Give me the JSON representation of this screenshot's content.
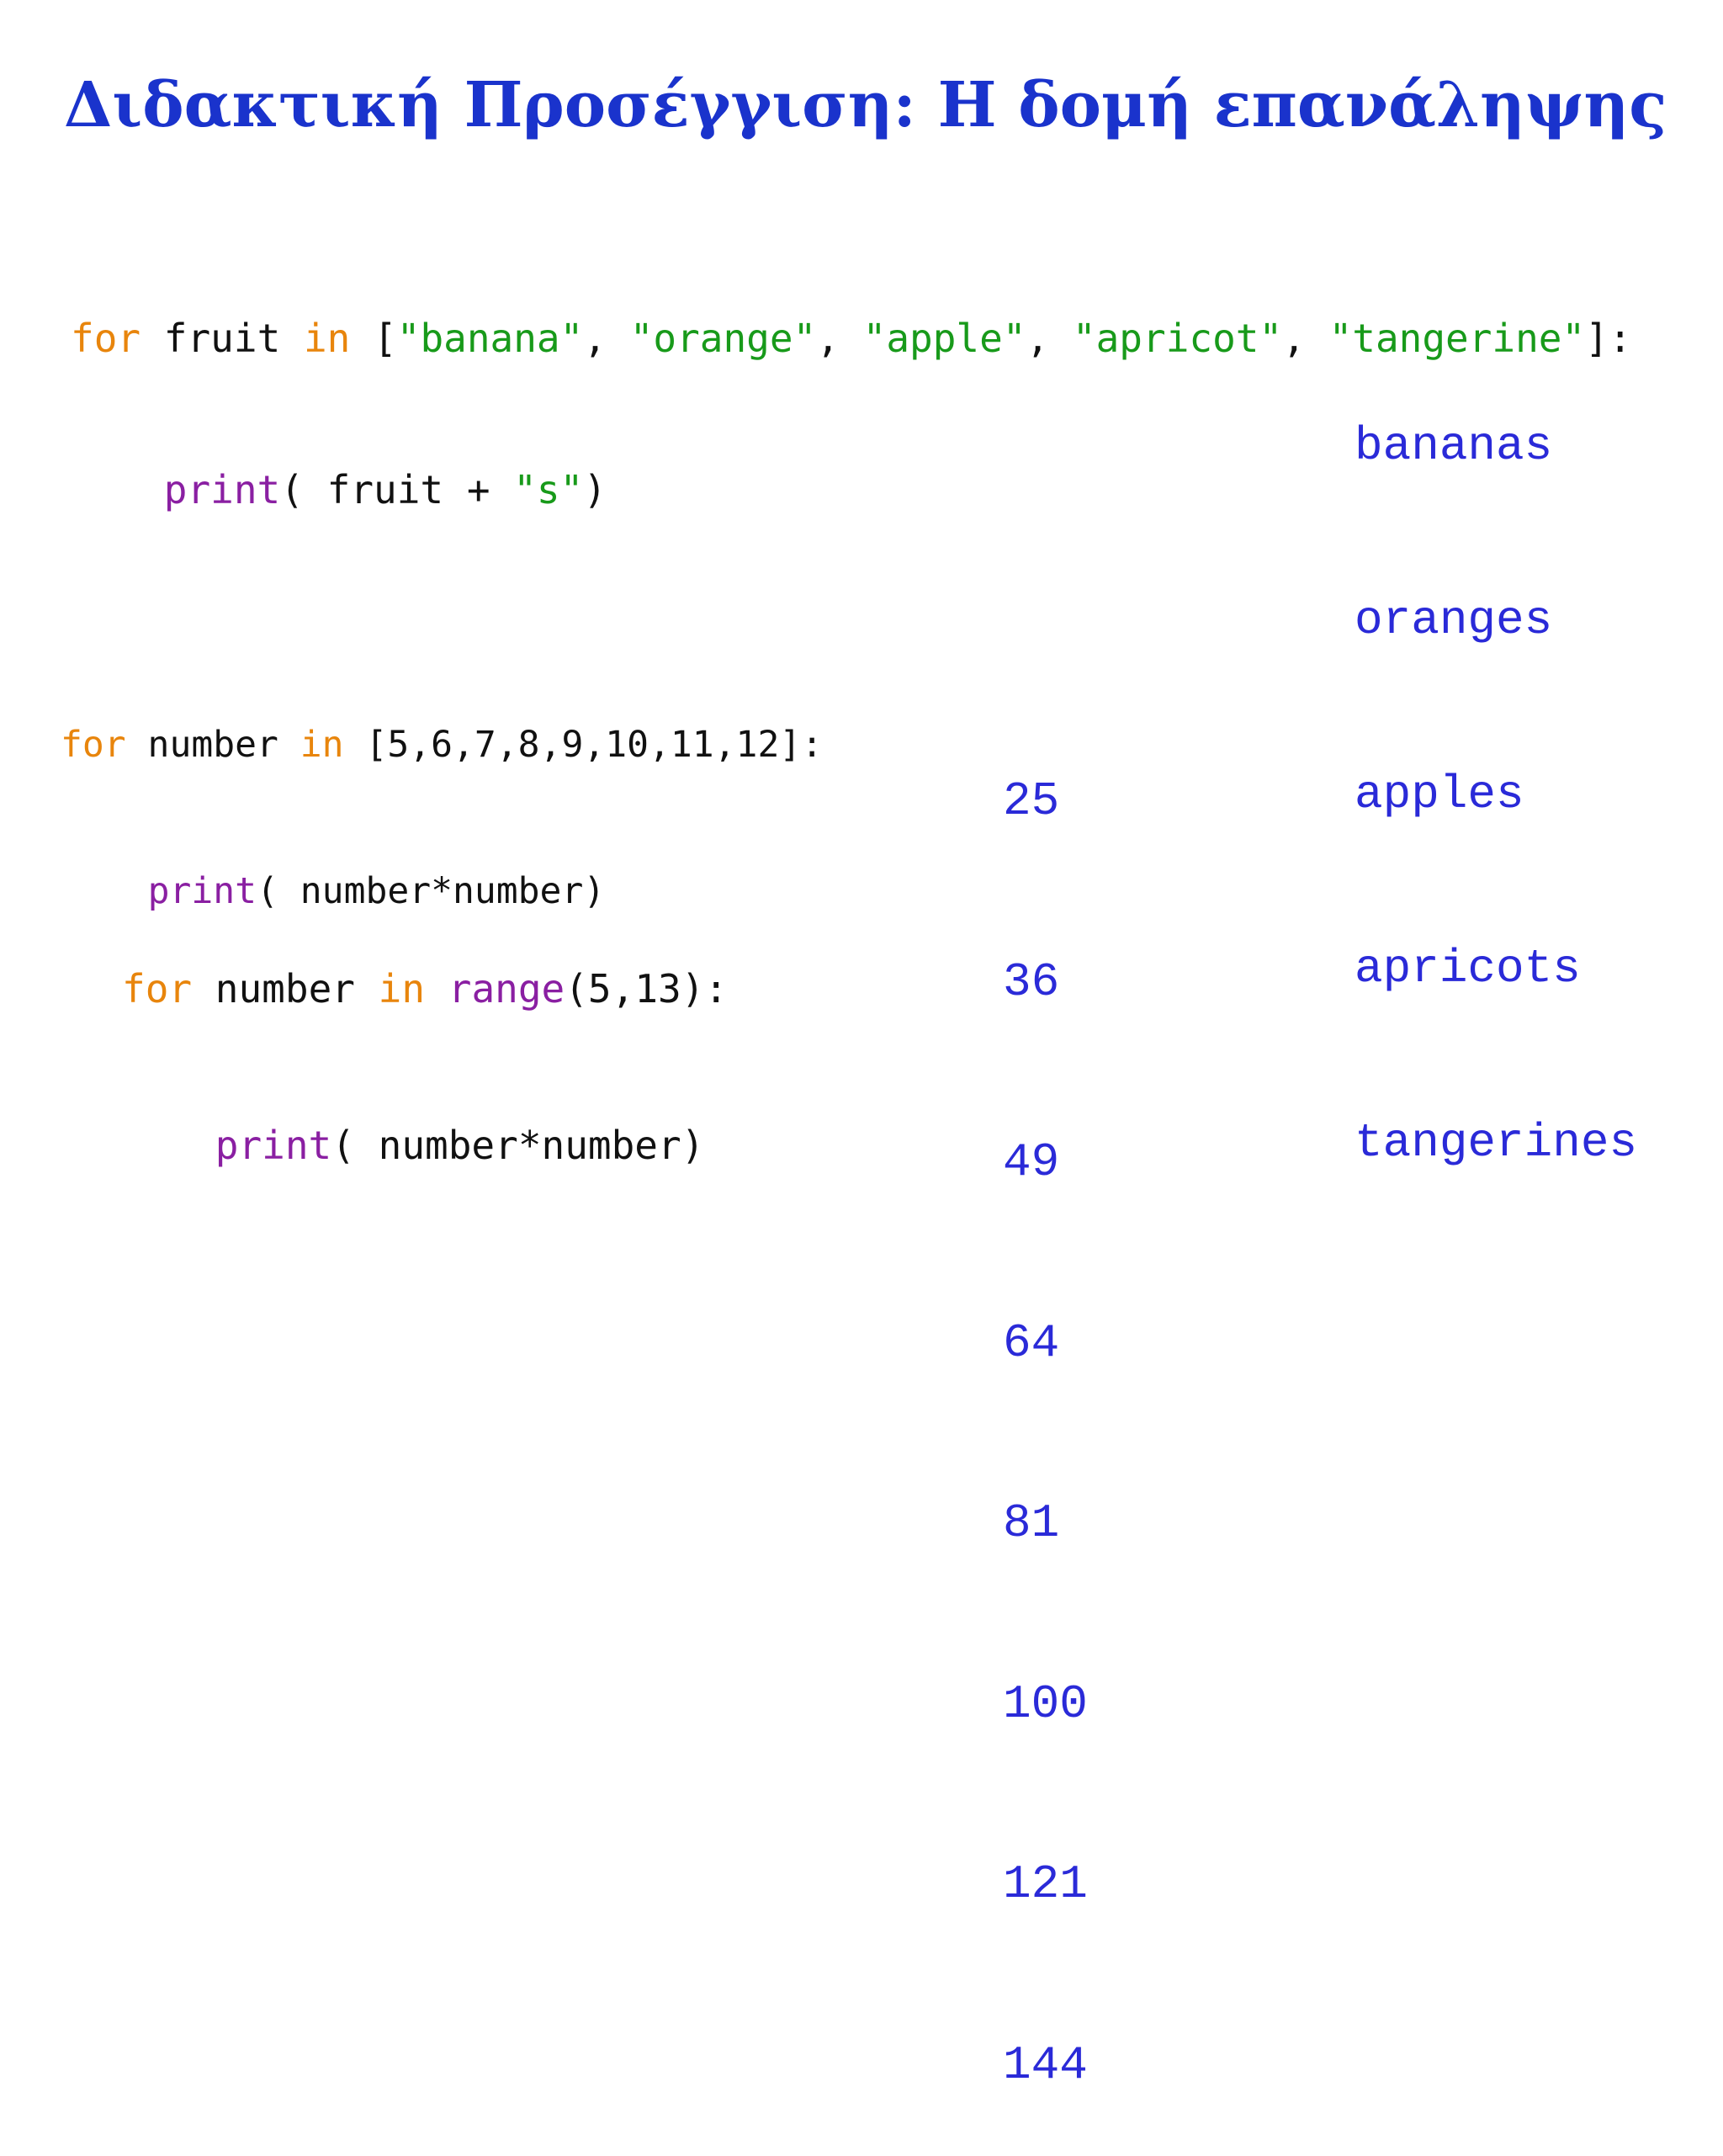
{
  "slide": {
    "title": "Διδακτική Προσέγγιση: Η δομή επανάληψης"
  },
  "code_block_1": {
    "line1": {
      "kw_for": "for",
      "var": " fruit ",
      "kw_in": "in",
      "open": " [",
      "s1": "\"banana\"",
      "c1": ", ",
      "s2": "\"orange\"",
      "c2": ", ",
      "s3": "\"apple\"",
      "c3": ", ",
      "s4": "\"apricot\"",
      "c4": ", ",
      "s5": "\"tangerine\"",
      "close": "]:"
    },
    "line2": {
      "indent": "    ",
      "fn": "print",
      "args": "( fruit + ",
      "str": "\"s\"",
      "close": ")"
    }
  },
  "output_1": [
    "bananas",
    "oranges",
    "apples",
    "apricots",
    "tangerines"
  ],
  "code_block_2": {
    "line1": {
      "kw_for": "for",
      "var": " number ",
      "kw_in": "in",
      "rest": " [5,6,7,8,9,10,11,12]:"
    },
    "line2": {
      "indent": "    ",
      "fn": "print",
      "args": "( number*number)"
    }
  },
  "code_block_3": {
    "line1": {
      "kw_for": "for",
      "var": " number ",
      "kw_in": "in",
      "space": " ",
      "fn_range": "range",
      "rest": "(5,13):"
    },
    "line2": {
      "indent": "    ",
      "fn": "print",
      "args": "( number*number)"
    }
  },
  "output_2": [
    "25",
    "36",
    "49",
    "64",
    "81",
    "100",
    "121",
    "144"
  ]
}
